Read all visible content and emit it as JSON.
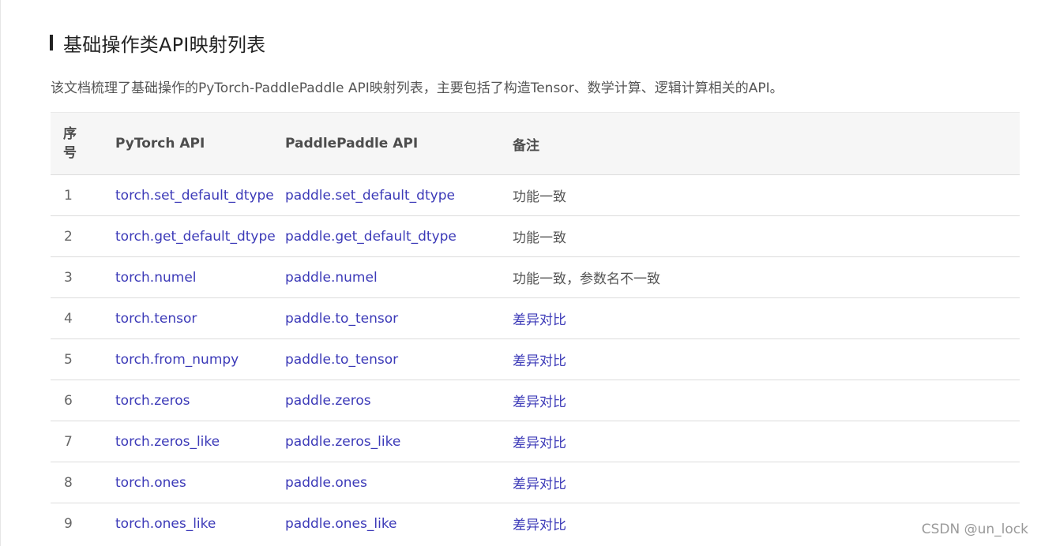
{
  "heading": "基础操作类API映射列表",
  "intro": "该文档梳理了基础操作的PyTorch-PaddlePaddle API映射列表，主要包括了构造Tensor、数学计算、逻辑计算相关的API。",
  "table": {
    "headers": {
      "index": "序号",
      "pytorch": "PyTorch API",
      "paddle": "PaddlePaddle API",
      "note": "备注"
    },
    "rows": [
      {
        "index": "1",
        "pytorch": "torch.set_default_dtype",
        "paddle": "paddle.set_default_dtype",
        "note": "功能一致",
        "note_is_link": false
      },
      {
        "index": "2",
        "pytorch": "torch.get_default_dtype",
        "paddle": "paddle.get_default_dtype",
        "note": "功能一致",
        "note_is_link": false
      },
      {
        "index": "3",
        "pytorch": "torch.numel",
        "paddle": "paddle.numel",
        "note": "功能一致，参数名不一致",
        "note_is_link": false
      },
      {
        "index": "4",
        "pytorch": "torch.tensor",
        "paddle": "paddle.to_tensor",
        "note": "差异对比",
        "note_is_link": true
      },
      {
        "index": "5",
        "pytorch": "torch.from_numpy",
        "paddle": "paddle.to_tensor",
        "note": "差异对比",
        "note_is_link": true
      },
      {
        "index": "6",
        "pytorch": "torch.zeros",
        "paddle": "paddle.zeros",
        "note": "差异对比",
        "note_is_link": true
      },
      {
        "index": "7",
        "pytorch": "torch.zeros_like",
        "paddle": "paddle.zeros_like",
        "note": "差异对比",
        "note_is_link": true
      },
      {
        "index": "8",
        "pytorch": "torch.ones",
        "paddle": "paddle.ones",
        "note": "差异对比",
        "note_is_link": true
      },
      {
        "index": "9",
        "pytorch": "torch.ones_like",
        "paddle": "paddle.ones_like",
        "note": "差异对比",
        "note_is_link": true
      }
    ]
  },
  "watermark": "CSDN @un_lock",
  "colors": {
    "link": "#3c3ab8",
    "text": "#555555",
    "header_bg": "#f6f6f6"
  }
}
